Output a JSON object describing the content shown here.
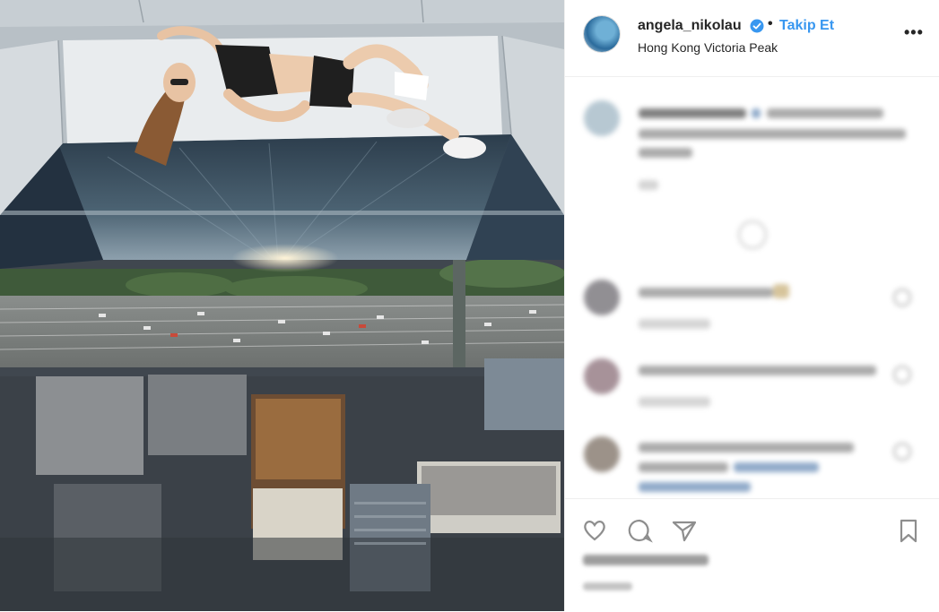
{
  "post": {
    "username": "angela_nikolau",
    "follow_separator": "•",
    "follow_label": "Takip Et",
    "location": "Hong Kong Victoria Peak",
    "more_label": "•••"
  },
  "colors": {
    "accent": "#3897f0",
    "text": "#262626",
    "border": "#efefef"
  },
  "icons": [
    "verified-badge-icon",
    "more-options-icon",
    "heart-icon",
    "comment-icon",
    "share-icon",
    "bookmark-icon",
    "load-more-icon"
  ]
}
